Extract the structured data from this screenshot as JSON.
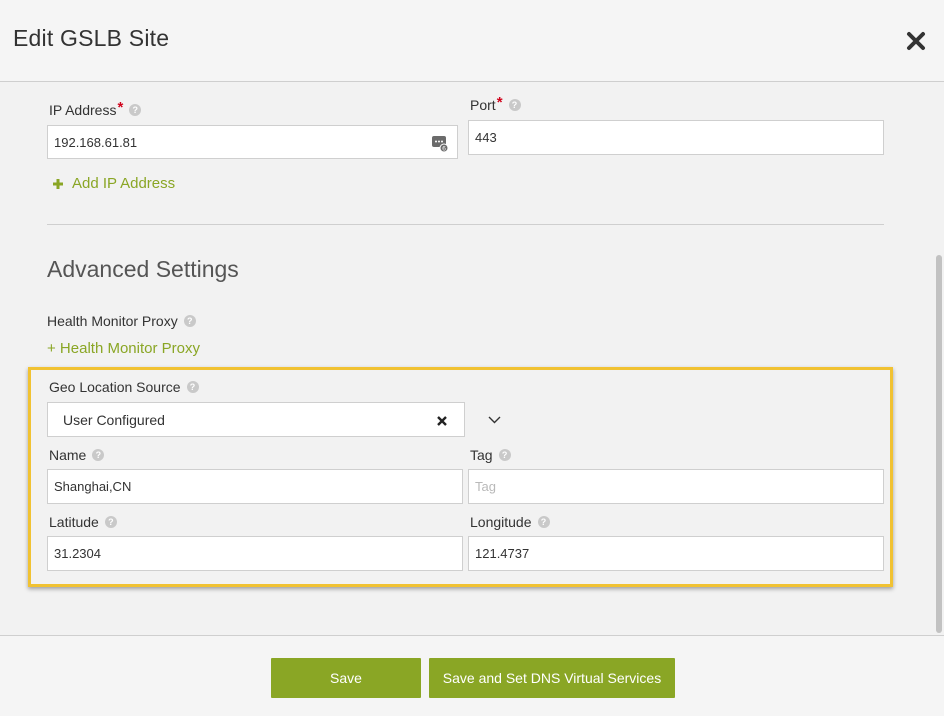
{
  "dialog": {
    "title": "Edit GSLB Site"
  },
  "ip_address": {
    "label": "IP Address",
    "required_mark": "*",
    "value": "192.168.61.81",
    "add_label": "Add IP Address"
  },
  "port": {
    "label": "Port",
    "required_mark": "*",
    "value": "443"
  },
  "advanced": {
    "title": "Advanced Settings",
    "health_monitor_proxy_label": "Health Monitor Proxy",
    "health_monitor_proxy_add": "+ Health Monitor Proxy"
  },
  "geo": {
    "source_label": "Geo Location Source",
    "source_value": "User Configured",
    "name_label": "Name",
    "name_value": "Shanghai,CN",
    "tag_label": "Tag",
    "tag_placeholder": "Tag",
    "latitude_label": "Latitude",
    "latitude_value": "31.2304",
    "longitude_label": "Longitude",
    "longitude_value": "121.4737"
  },
  "footer": {
    "save_label": "Save",
    "save_dns_label": "Save and Set DNS Virtual Services"
  },
  "colors": {
    "accent": "#8aa625",
    "required": "#d0021b",
    "highlight": "#f1c232"
  },
  "icons": {
    "close": "close-icon",
    "help": "help-icon",
    "plus": "plus-icon",
    "ip_type": "ip-type-icon",
    "clear": "clear-icon",
    "chevron": "chevron-down-icon"
  }
}
